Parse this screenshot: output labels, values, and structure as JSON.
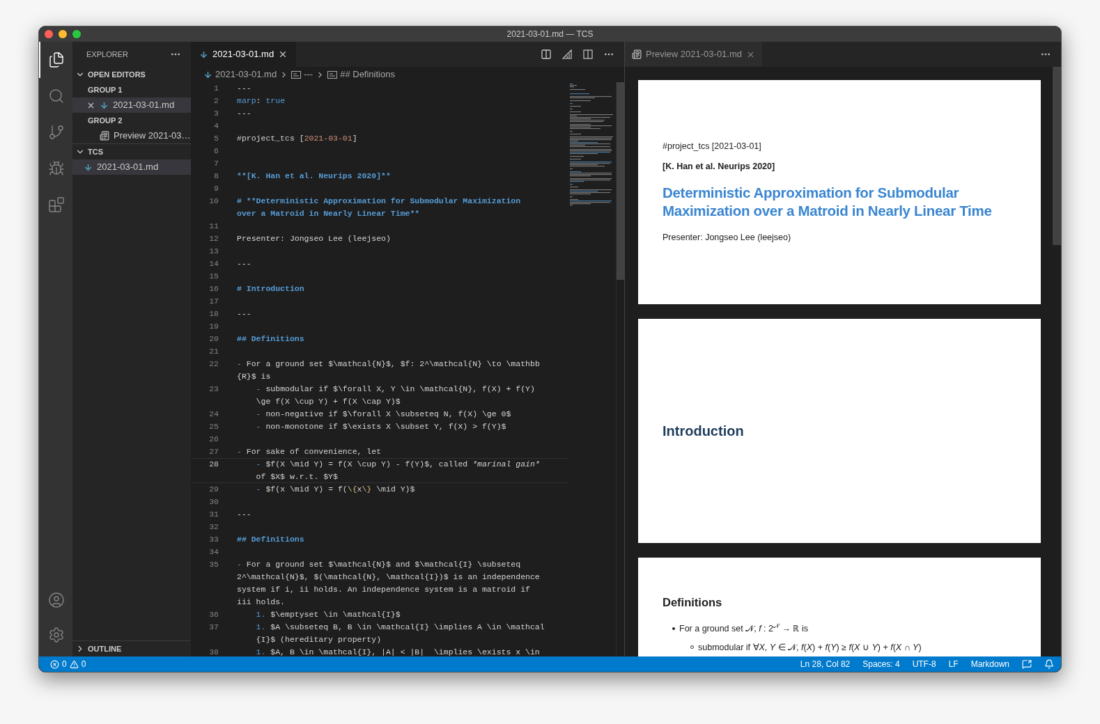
{
  "window": {
    "title": "2021-03-01.md — TCS"
  },
  "activity_bar": {
    "items": [
      {
        "selected": true
      },
      {
        "selected": false
      },
      {
        "selected": false
      },
      {
        "selected": false
      },
      {
        "selected": false
      }
    ],
    "bottom": [
      {
        "selected": false
      },
      {
        "selected": false
      }
    ]
  },
  "sidebar": {
    "title": "EXPLORER",
    "sections": [
      {
        "label": "OPEN EDITORS",
        "expanded": true,
        "groups": [
          {
            "label": "GROUP 1",
            "items": [
              {
                "label": "2021-03-01.md",
                "kind": "markdown",
                "selected": true
              }
            ]
          },
          {
            "label": "GROUP 2",
            "items": [
              {
                "label": "Preview 2021-03…",
                "kind": "preview",
                "selected": false
              }
            ]
          }
        ]
      },
      {
        "label": "TCS",
        "expanded": true,
        "groups": [
          {
            "items": [
              {
                "label": "2021-03-01.md",
                "kind": "markdown",
                "selected": true
              }
            ]
          }
        ]
      },
      {
        "label": "OUTLINE",
        "expanded": false
      }
    ]
  },
  "editor": {
    "tab": {
      "label": "2021-03-01.md",
      "selected": true
    },
    "breadcrumbs": [
      "2021-03-01.md",
      "---",
      "## Definitions"
    ],
    "lines": [
      {
        "number": "1",
        "rows": [
          [
            {
              "kind": "plain",
              "text": "---"
            }
          ]
        ]
      },
      {
        "number": "2",
        "rows": [
          [
            {
              "kind": "keyword",
              "text": "marp"
            },
            {
              "kind": "plain",
              "text": ": "
            },
            {
              "kind": "keyword",
              "text": "true"
            }
          ]
        ]
      },
      {
        "number": "3",
        "rows": [
          [
            {
              "kind": "plain",
              "text": "---"
            }
          ]
        ]
      },
      {
        "number": "4"
      },
      {
        "number": "5",
        "rows": [
          [
            {
              "kind": "plain",
              "text": "#project_tcs ["
            },
            {
              "kind": "string",
              "text": "2021-03-01"
            },
            {
              "kind": "plain",
              "text": "]"
            }
          ]
        ]
      },
      {
        "number": "6"
      },
      {
        "number": "7"
      },
      {
        "number": "8",
        "rows": [
          [
            {
              "kind": "heading",
              "text": "**[K. Han et al. Neurips 2020]**"
            }
          ]
        ]
      },
      {
        "number": "9"
      },
      {
        "number": "10",
        "rows": [
          [
            {
              "kind": "heading",
              "text": "# **Deterministic Approximation for Submodular Maximization"
            }
          ],
          [
            {
              "kind": "heading",
              "text": "over a Matroid in Nearly Linear Time**"
            }
          ]
        ]
      },
      {
        "number": "11"
      },
      {
        "number": "12",
        "rows": [
          [
            {
              "kind": "plain",
              "text": "Presenter: Jongseo Lee (leejseo)"
            }
          ]
        ]
      },
      {
        "number": "13"
      },
      {
        "number": "14",
        "rows": [
          [
            {
              "kind": "plain",
              "text": "---"
            }
          ]
        ]
      },
      {
        "number": "15"
      },
      {
        "number": "16",
        "rows": [
          [
            {
              "kind": "heading",
              "text": "# Introduction"
            }
          ]
        ]
      },
      {
        "number": "17"
      },
      {
        "number": "18",
        "rows": [
          [
            {
              "kind": "plain",
              "text": "---"
            }
          ]
        ]
      },
      {
        "number": "19"
      },
      {
        "number": "20",
        "rows": [
          [
            {
              "kind": "heading",
              "text": "## Definitions"
            }
          ]
        ]
      },
      {
        "number": "21"
      },
      {
        "number": "22",
        "rows": [
          [
            {
              "kind": "keyword",
              "text": "- "
            },
            {
              "kind": "plain",
              "text": "For a ground set $\\mathcal{N}$, $f: 2^\\mathcal{N} \\to \\mathbb"
            }
          ],
          [
            {
              "kind": "plain",
              "text": "{R}$ is"
            }
          ]
        ]
      },
      {
        "number": "23",
        "rows": [
          [
            {
              "kind": "keyword",
              "text": "    - "
            },
            {
              "kind": "plain",
              "text": "submodular if $\\forall X, Y \\in \\mathcal{N}, f(X) + f(Y)"
            }
          ],
          [
            {
              "kind": "plain",
              "text": "    \\ge f(X \\cup Y) + f(X \\cap Y)$"
            }
          ]
        ]
      },
      {
        "number": "24",
        "rows": [
          [
            {
              "kind": "keyword",
              "text": "    - "
            },
            {
              "kind": "plain",
              "text": "non-negative if $\\forall X \\subseteq N, f(X) \\ge 0$"
            }
          ]
        ]
      },
      {
        "number": "25",
        "rows": [
          [
            {
              "kind": "keyword",
              "text": "    - "
            },
            {
              "kind": "plain",
              "text": "non-monotone if $\\exists X \\subset Y, f(X) > f(Y)$"
            }
          ]
        ]
      },
      {
        "number": "26"
      },
      {
        "number": "27",
        "rows": [
          [
            {
              "kind": "keyword",
              "text": "- "
            },
            {
              "kind": "plain",
              "text": "For sake of convenience, let"
            }
          ]
        ]
      },
      {
        "number": "28",
        "current": true,
        "rows": [
          [
            {
              "kind": "keyword",
              "text": "    - "
            },
            {
              "kind": "plain",
              "text": "$f(X \\mid Y) = f(X \\cup Y) - f(Y)$, called "
            },
            {
              "kind": "italic",
              "text": "*marinal gain*"
            }
          ],
          [
            {
              "kind": "plain",
              "text": "    of $X$ w.r.t. $Y$"
            }
          ]
        ]
      },
      {
        "number": "29",
        "rows": [
          [
            {
              "kind": "keyword",
              "text": "    - "
            },
            {
              "kind": "plain",
              "text": "$f(x \\mid Y) = f("
            },
            {
              "kind": "escape",
              "text": "\\{"
            },
            {
              "kind": "plain",
              "text": "x"
            },
            {
              "kind": "escape",
              "text": "\\}"
            },
            {
              "kind": "plain",
              "text": " \\mid Y)$"
            }
          ]
        ]
      },
      {
        "number": "30"
      },
      {
        "number": "31",
        "rows": [
          [
            {
              "kind": "plain",
              "text": "---"
            }
          ]
        ]
      },
      {
        "number": "32"
      },
      {
        "number": "33",
        "rows": [
          [
            {
              "kind": "heading",
              "text": "## Definitions"
            }
          ]
        ]
      },
      {
        "number": "34"
      },
      {
        "number": "35",
        "rows": [
          [
            {
              "kind": "keyword",
              "text": "- "
            },
            {
              "kind": "plain",
              "text": "For a ground set $\\mathcal{N}$ and $\\mathcal{I} \\subseteq"
            }
          ],
          [
            {
              "kind": "plain",
              "text": "2^\\mathcal{N}$, $(\\mathcal{N}, \\mathcal{I})$ is an independence"
            }
          ],
          [
            {
              "kind": "plain",
              "text": "system if i, ii holds. An independence system is a matroid if"
            }
          ],
          [
            {
              "kind": "plain",
              "text": "iii holds."
            }
          ]
        ]
      },
      {
        "number": "36",
        "rows": [
          [
            {
              "kind": "keyword",
              "text": "    1. "
            },
            {
              "kind": "plain",
              "text": "$\\emptyset \\in \\mathcal{I}$"
            }
          ]
        ]
      },
      {
        "number": "37",
        "rows": [
          [
            {
              "kind": "keyword",
              "text": "    1. "
            },
            {
              "kind": "plain",
              "text": "$A \\subseteq B, B \\in \\mathcal{I} \\implies A \\in \\mathcal"
            }
          ],
          [
            {
              "kind": "plain",
              "text": "    {I}$ (hereditary property)"
            }
          ]
        ]
      },
      {
        "number": "38",
        "rows": [
          [
            {
              "kind": "keyword",
              "text": "    1. "
            },
            {
              "kind": "plain",
              "text": "$A, B \\in \\mathcal{I}, |A| < |B|  \\implies \\exists x \\in"
            }
          ]
        ]
      }
    ]
  },
  "preview": {
    "tab": {
      "label": "Preview 2021-03-01.md",
      "selected": false
    },
    "slides": [
      {
        "items": [
          {
            "kind": "text",
            "text": "#project_tcs [2021-03-01]"
          },
          {
            "kind": "bold",
            "text": "[K. Han et al. Neurips 2020]"
          },
          {
            "kind": "title",
            "text": "Deterministic Approximation for Submodular Maximization over a Matroid in Nearly Linear Time"
          },
          {
            "kind": "text",
            "text": "Presenter: Jongseo Lee (leejseo)"
          }
        ]
      },
      {
        "items": [
          {
            "kind": "title2",
            "text": "Introduction"
          }
        ]
      },
      {
        "items": [
          {
            "kind": "subheading",
            "text": "Definitions"
          },
          {
            "kind": "bullet",
            "text": "For a ground set 𝒩, *f* : 2$^{𝒩}$ → ℝ is"
          },
          {
            "kind": "subbullet",
            "text": "submodular if ∀*X*, *Y* ∈ 𝒩, *f*(*X*) + *f*(*Y*) ≥ *f*(*X* ∪ *Y*) + *f*(*X* ∩ *Y*)"
          }
        ]
      }
    ]
  },
  "status_bar": {
    "errors": "0",
    "warnings": "0",
    "items": [
      "Ln 28, Col 82",
      "Spaces: 4",
      "UTF-8",
      "LF",
      "Markdown"
    ]
  }
}
